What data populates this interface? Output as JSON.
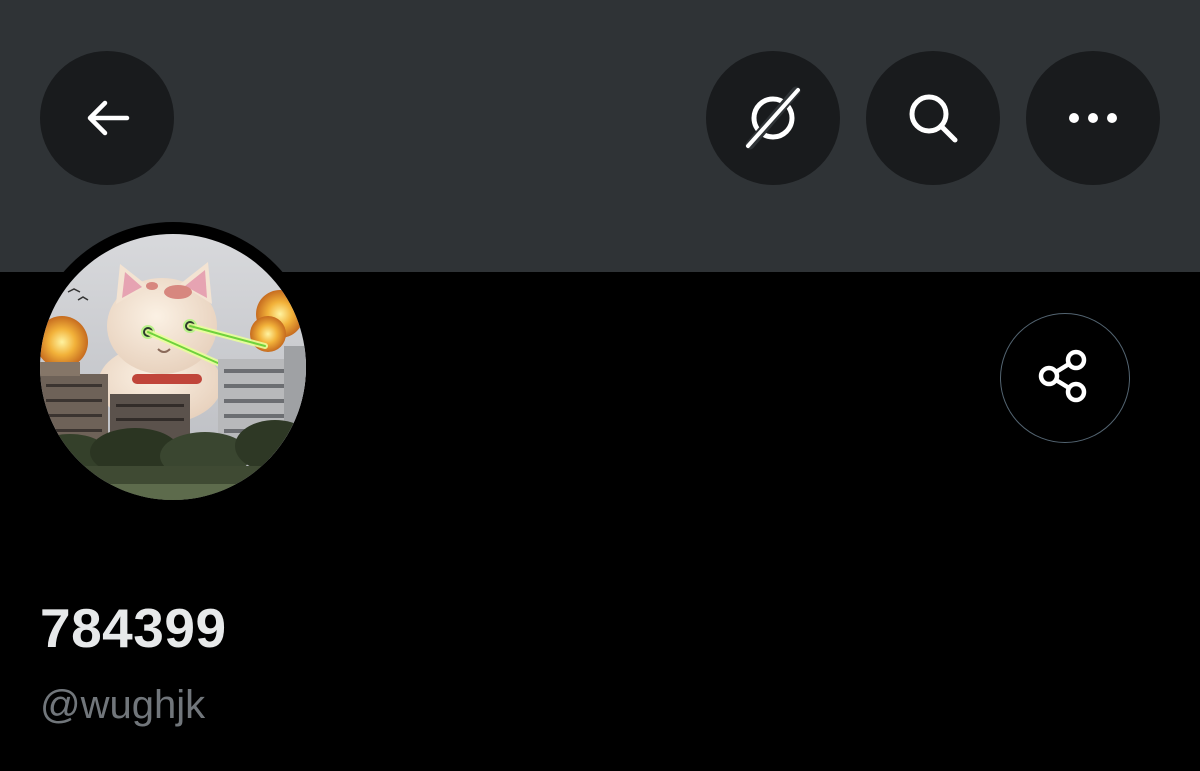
{
  "header": {
    "back_icon": "arrow-left-icon",
    "grok_icon": "grok-icon",
    "search_icon": "search-icon",
    "more_icon": "more-horizontal-icon",
    "banner_color": "#2f3336",
    "button_bg": "#191b1d"
  },
  "profile": {
    "display_name": "784399",
    "handle": "@wughjk",
    "avatar_alt": "",
    "share_icon": "share-icon"
  },
  "colors": {
    "background": "#000000",
    "primary_text": "#e7e9ea",
    "secondary_text": "#71767b",
    "border": "#536471"
  }
}
